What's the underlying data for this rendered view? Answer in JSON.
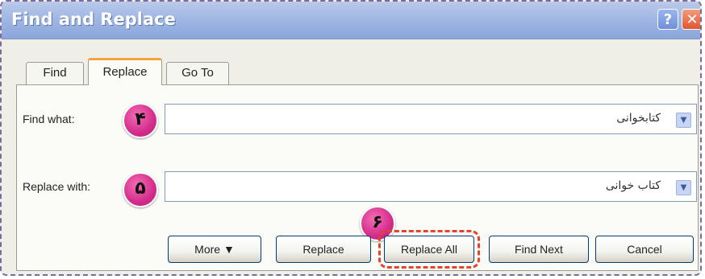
{
  "window": {
    "title": "Find and Replace",
    "help_glyph": "?",
    "close_glyph": "✕"
  },
  "tabs": [
    {
      "label": "Find",
      "active": false
    },
    {
      "label": "Replace",
      "active": true
    },
    {
      "label": "Go To",
      "active": false
    }
  ],
  "find": {
    "label": "Find what:",
    "value": "کتابخوانی",
    "step": "۴"
  },
  "replace": {
    "label": "Replace with:",
    "value": "کتاب خوانی‌",
    "step": "۵"
  },
  "buttons": {
    "more": "More ▼",
    "replace": "Replace",
    "replace_all": "Replace All",
    "find_next": "Find Next",
    "cancel": "Cancel",
    "step": "۶"
  },
  "colors": {
    "badge": "#d42c8c",
    "focus_outline": "#e2452b",
    "tab_accent": "#f1a43c"
  }
}
